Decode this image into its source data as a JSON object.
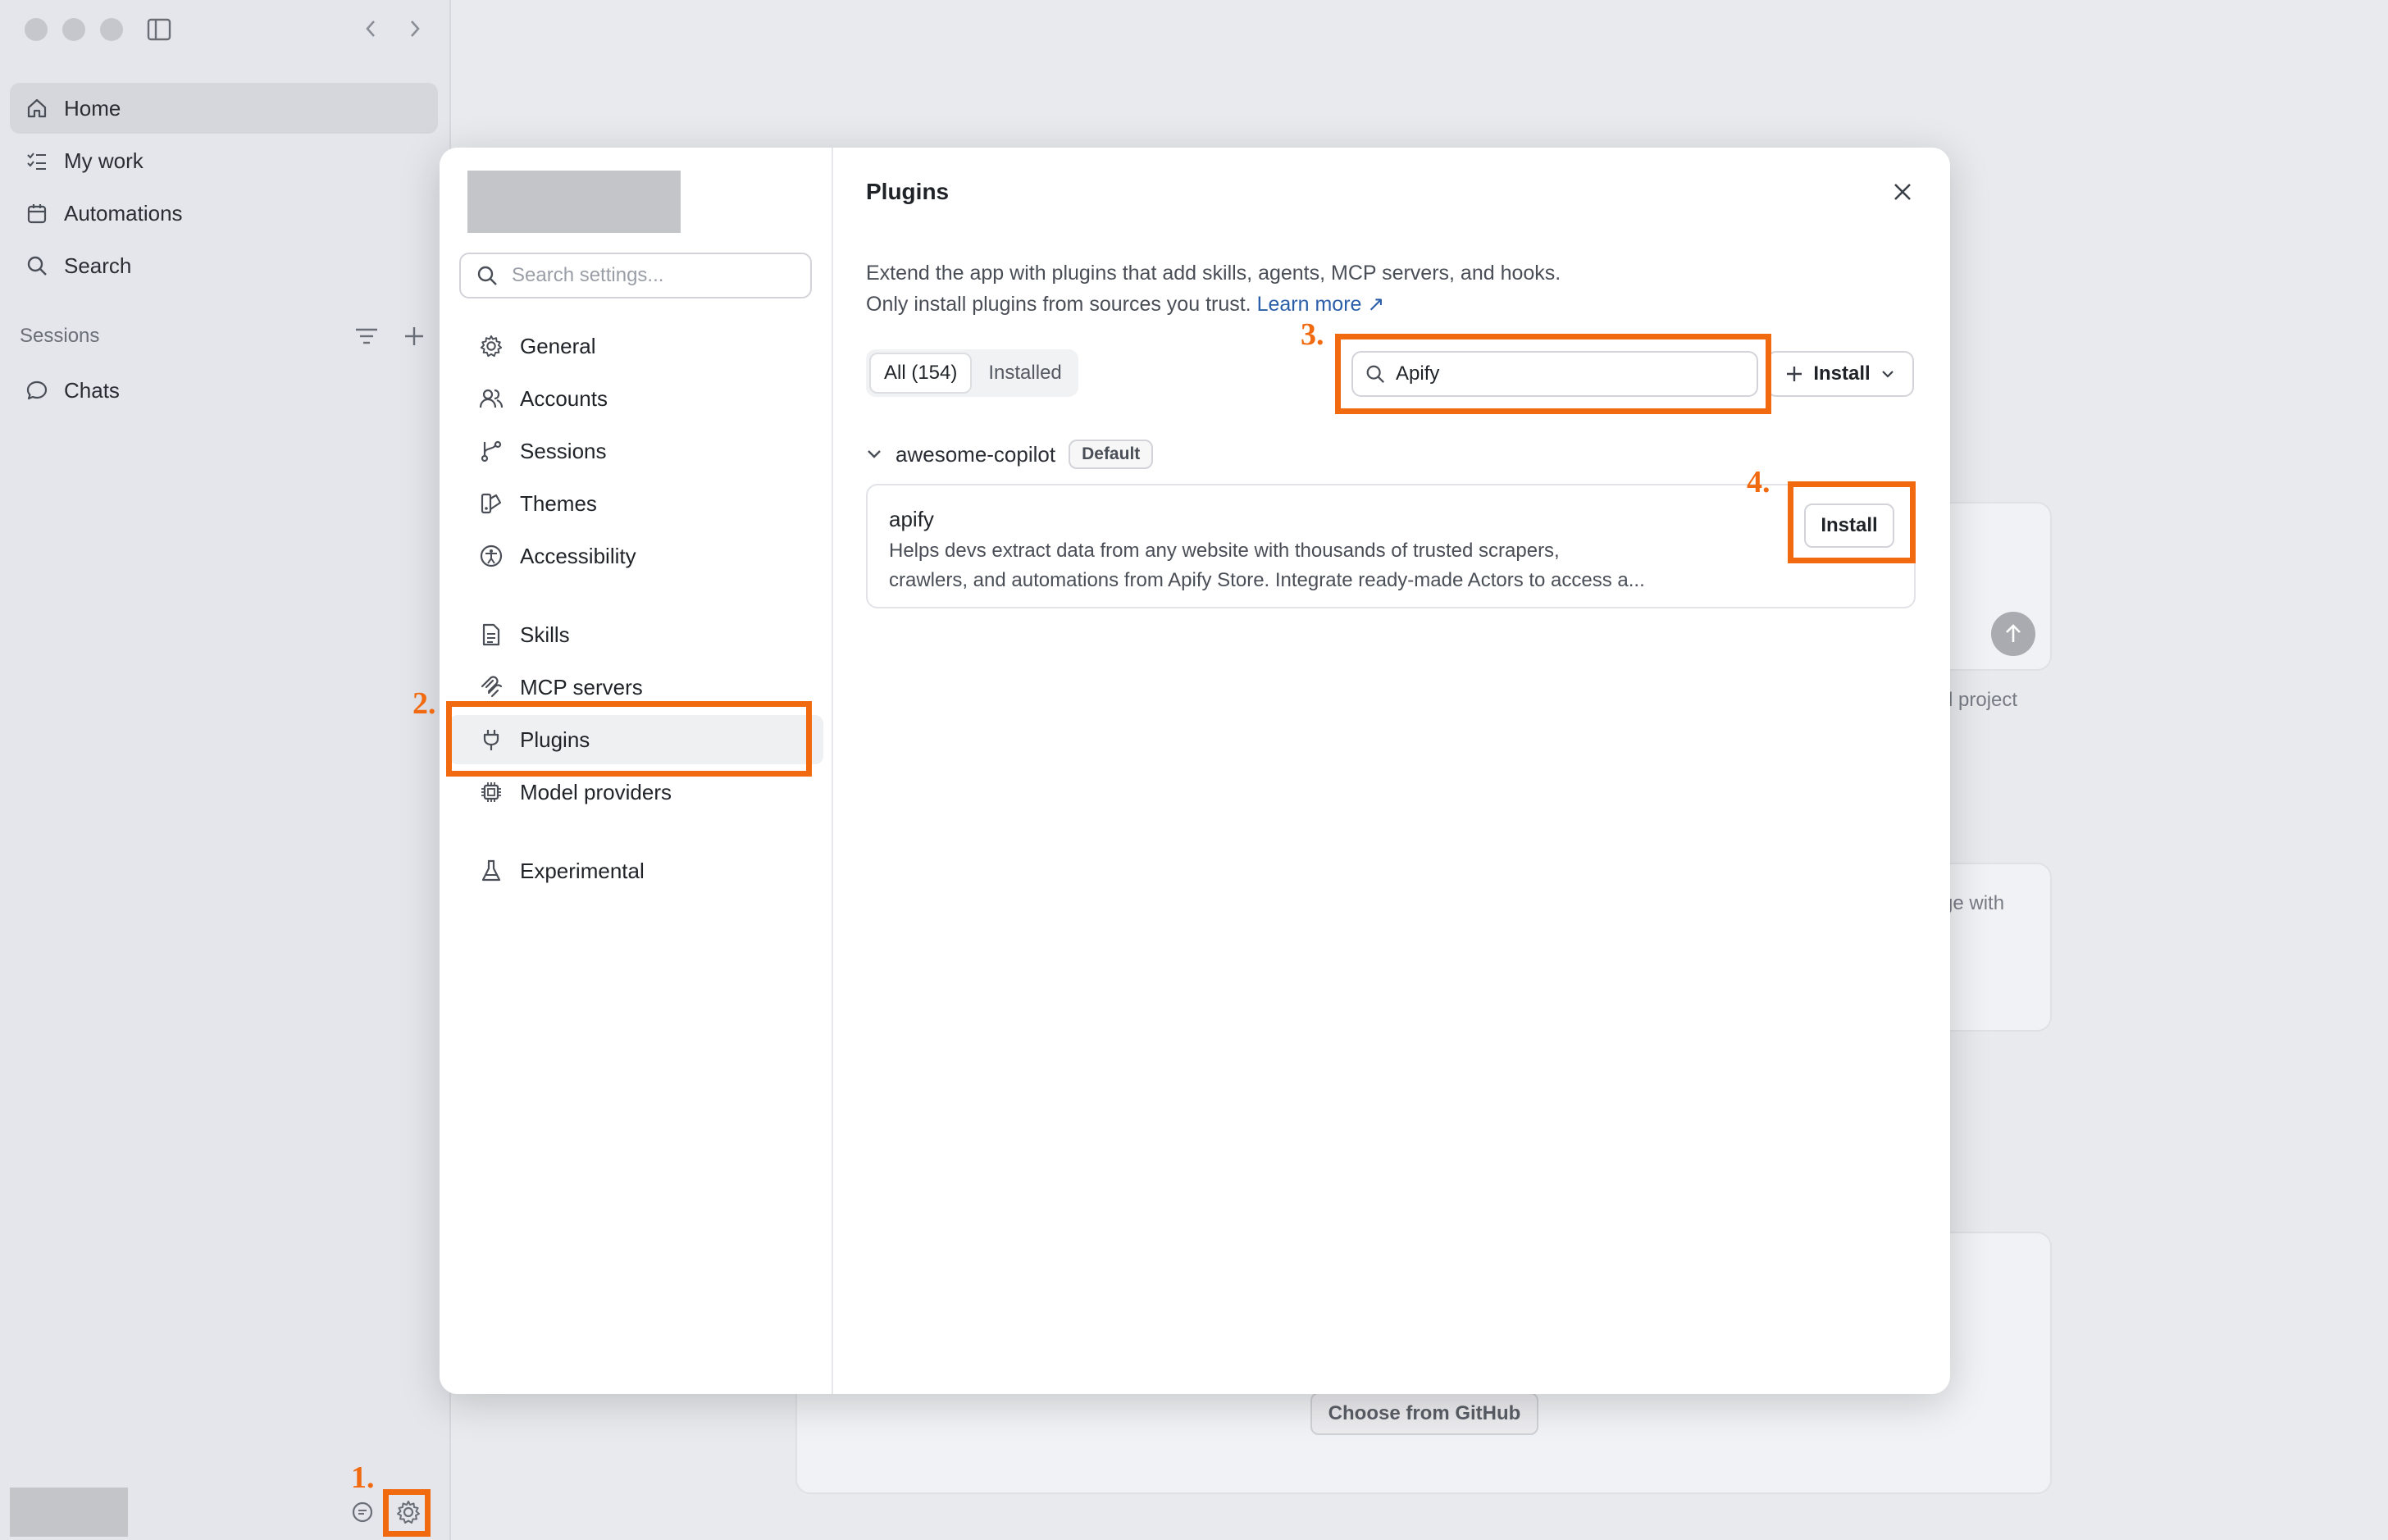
{
  "sidebar": {
    "nav": [
      {
        "label": "Home",
        "icon": "home-icon"
      },
      {
        "label": "My work",
        "icon": "checklist-icon"
      },
      {
        "label": "Automations",
        "icon": "calendar-icon"
      },
      {
        "label": "Search",
        "icon": "search-icon"
      }
    ],
    "sessions_label": "Sessions",
    "sessions": [
      {
        "label": "Chats",
        "icon": "chat-bubble-icon"
      }
    ]
  },
  "background": {
    "project_text": "d project",
    "with_text": "ge with",
    "github_button": "Choose from GitHub"
  },
  "settings": {
    "search_placeholder": "Search settings...",
    "nav_items": [
      {
        "label": "General",
        "icon": "gear-icon"
      },
      {
        "label": "Accounts",
        "icon": "users-icon"
      },
      {
        "label": "Sessions",
        "icon": "branch-icon"
      },
      {
        "label": "Themes",
        "icon": "palette-icon"
      },
      {
        "label": "Accessibility",
        "icon": "accessibility-icon"
      },
      {
        "label": "Skills",
        "icon": "document-icon"
      },
      {
        "label": "MCP servers",
        "icon": "mcp-icon"
      },
      {
        "label": "Plugins",
        "icon": "plug-icon"
      },
      {
        "label": "Model providers",
        "icon": "chip-icon"
      },
      {
        "label": "Experimental",
        "icon": "flask-icon"
      }
    ],
    "active_item": "Plugins"
  },
  "plugins": {
    "title": "Plugins",
    "description_line1": "Extend the app with plugins that add skills, agents, MCP servers, and hooks.",
    "description_line2": "Only install plugins from sources you trust.",
    "learn_more": "Learn more ↗",
    "tabs": [
      {
        "label": "All (154)",
        "active": true
      },
      {
        "label": "Installed",
        "active": false
      }
    ],
    "search_value": "Apify",
    "install_button": "Install",
    "group": {
      "name": "awesome-copilot",
      "badge": "Default"
    },
    "items": [
      {
        "name": "apify",
        "description_line1": "Helps devs extract data from any website with thousands of trusted scrapers,",
        "description_line2": "crawlers, and automations from Apify Store. Integrate ready-made Actors to access a...",
        "install_label": "Install"
      }
    ]
  },
  "annotations": {
    "step1": "1.",
    "step2": "2.",
    "step3": "3.",
    "step4": "4.",
    "color": "#f26a10"
  }
}
